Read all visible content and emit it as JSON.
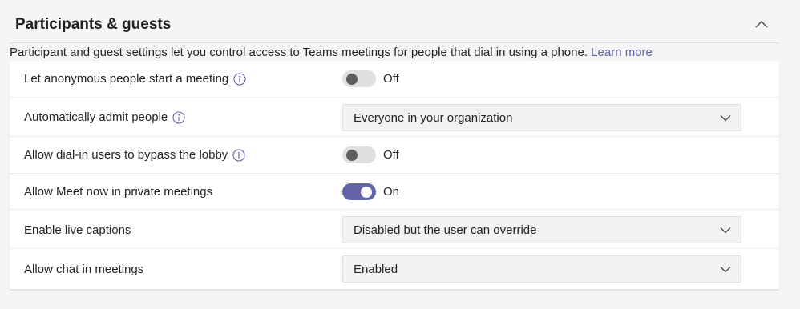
{
  "section": {
    "title": "Participants & guests",
    "description": "Participant and guest settings let you control access to Teams meetings for people that dial in using a phone.",
    "learn_more": "Learn more"
  },
  "settings": [
    {
      "label": "Let anonymous people start a meeting",
      "info": true,
      "control": "toggle",
      "state": "Off"
    },
    {
      "label": "Automatically admit people",
      "info": true,
      "control": "dropdown",
      "value": "Everyone in your organization"
    },
    {
      "label": "Allow dial-in users to bypass the lobby",
      "info": true,
      "control": "toggle",
      "state": "Off"
    },
    {
      "label": "Allow Meet now in private meetings",
      "info": false,
      "control": "toggle",
      "state": "On"
    },
    {
      "label": "Enable live captions",
      "info": false,
      "control": "dropdown",
      "value": "Disabled but the user can override"
    },
    {
      "label": "Allow chat in meetings",
      "info": false,
      "control": "dropdown",
      "value": "Enabled"
    }
  ],
  "icons": {
    "collapse": "chevron-up-icon",
    "info": "info-icon",
    "dropdown": "chevron-down-icon"
  },
  "colors": {
    "accent": "#6264a7",
    "toggle_off_track": "#e1dfdd",
    "toggle_off_knob": "#605e5c",
    "dropdown_bg": "#f3f2f1"
  }
}
